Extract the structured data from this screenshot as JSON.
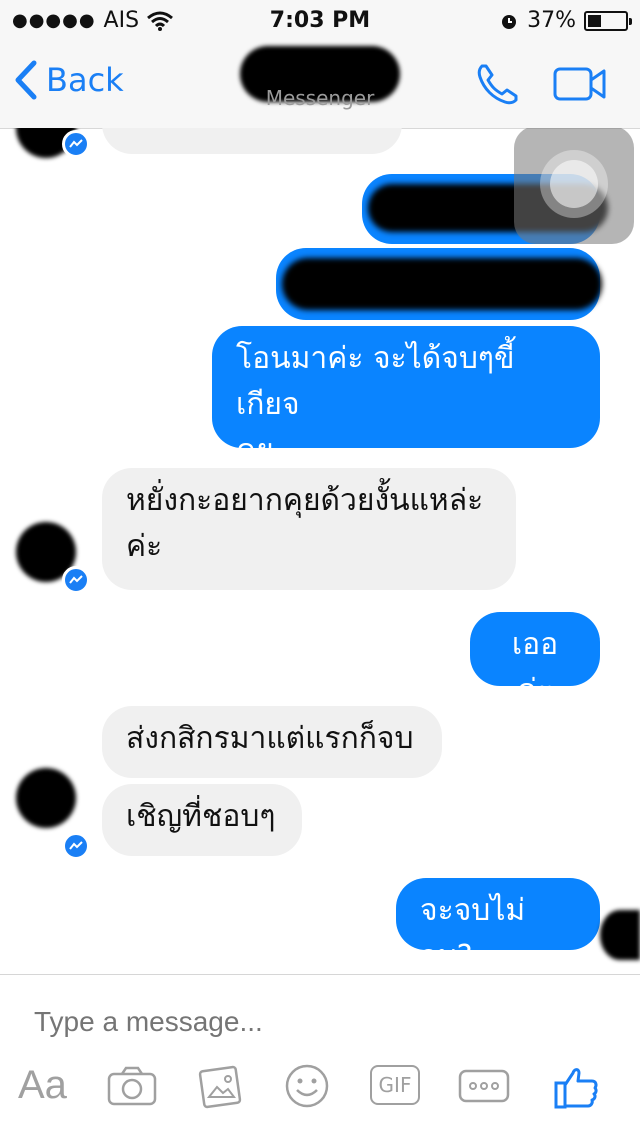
{
  "status_bar": {
    "signal": "●●●●●",
    "carrier": "AIS",
    "time": "7:03 PM",
    "battery": "37%",
    "battery_level": 0.37
  },
  "nav": {
    "back_label": "Back",
    "subtitle": "Messenger"
  },
  "messages": [
    {
      "side": "out",
      "text": "โอนมาค่ะ จะได้จบๆขี้เกียจคุย",
      "line1": "โอนมาค่ะ จะได้จบๆขี้เกียจ",
      "line2": "คุย"
    },
    {
      "side": "in",
      "line1": "หยั่งกะอยากคุยด้วยงั้นแหล่ะ",
      "line2": "ค่ะ"
    },
    {
      "side": "out",
      "text": "เออค่ะ"
    },
    {
      "side": "in",
      "text": "ส่งกสิกรมาแต่แรกก็จบ"
    },
    {
      "side": "in",
      "text": "เชิญที่ชอบๆ"
    },
    {
      "side": "out",
      "text": "จะจบไม่จบ?"
    }
  ],
  "composer": {
    "placeholder": "Type a message...",
    "aa_label": "Aa",
    "gif_label": "GIF"
  },
  "colors": {
    "accent": "#1a7ff5",
    "outgoing_bubble": "#0a84ff",
    "incoming_bubble": "#f0f0f0"
  }
}
